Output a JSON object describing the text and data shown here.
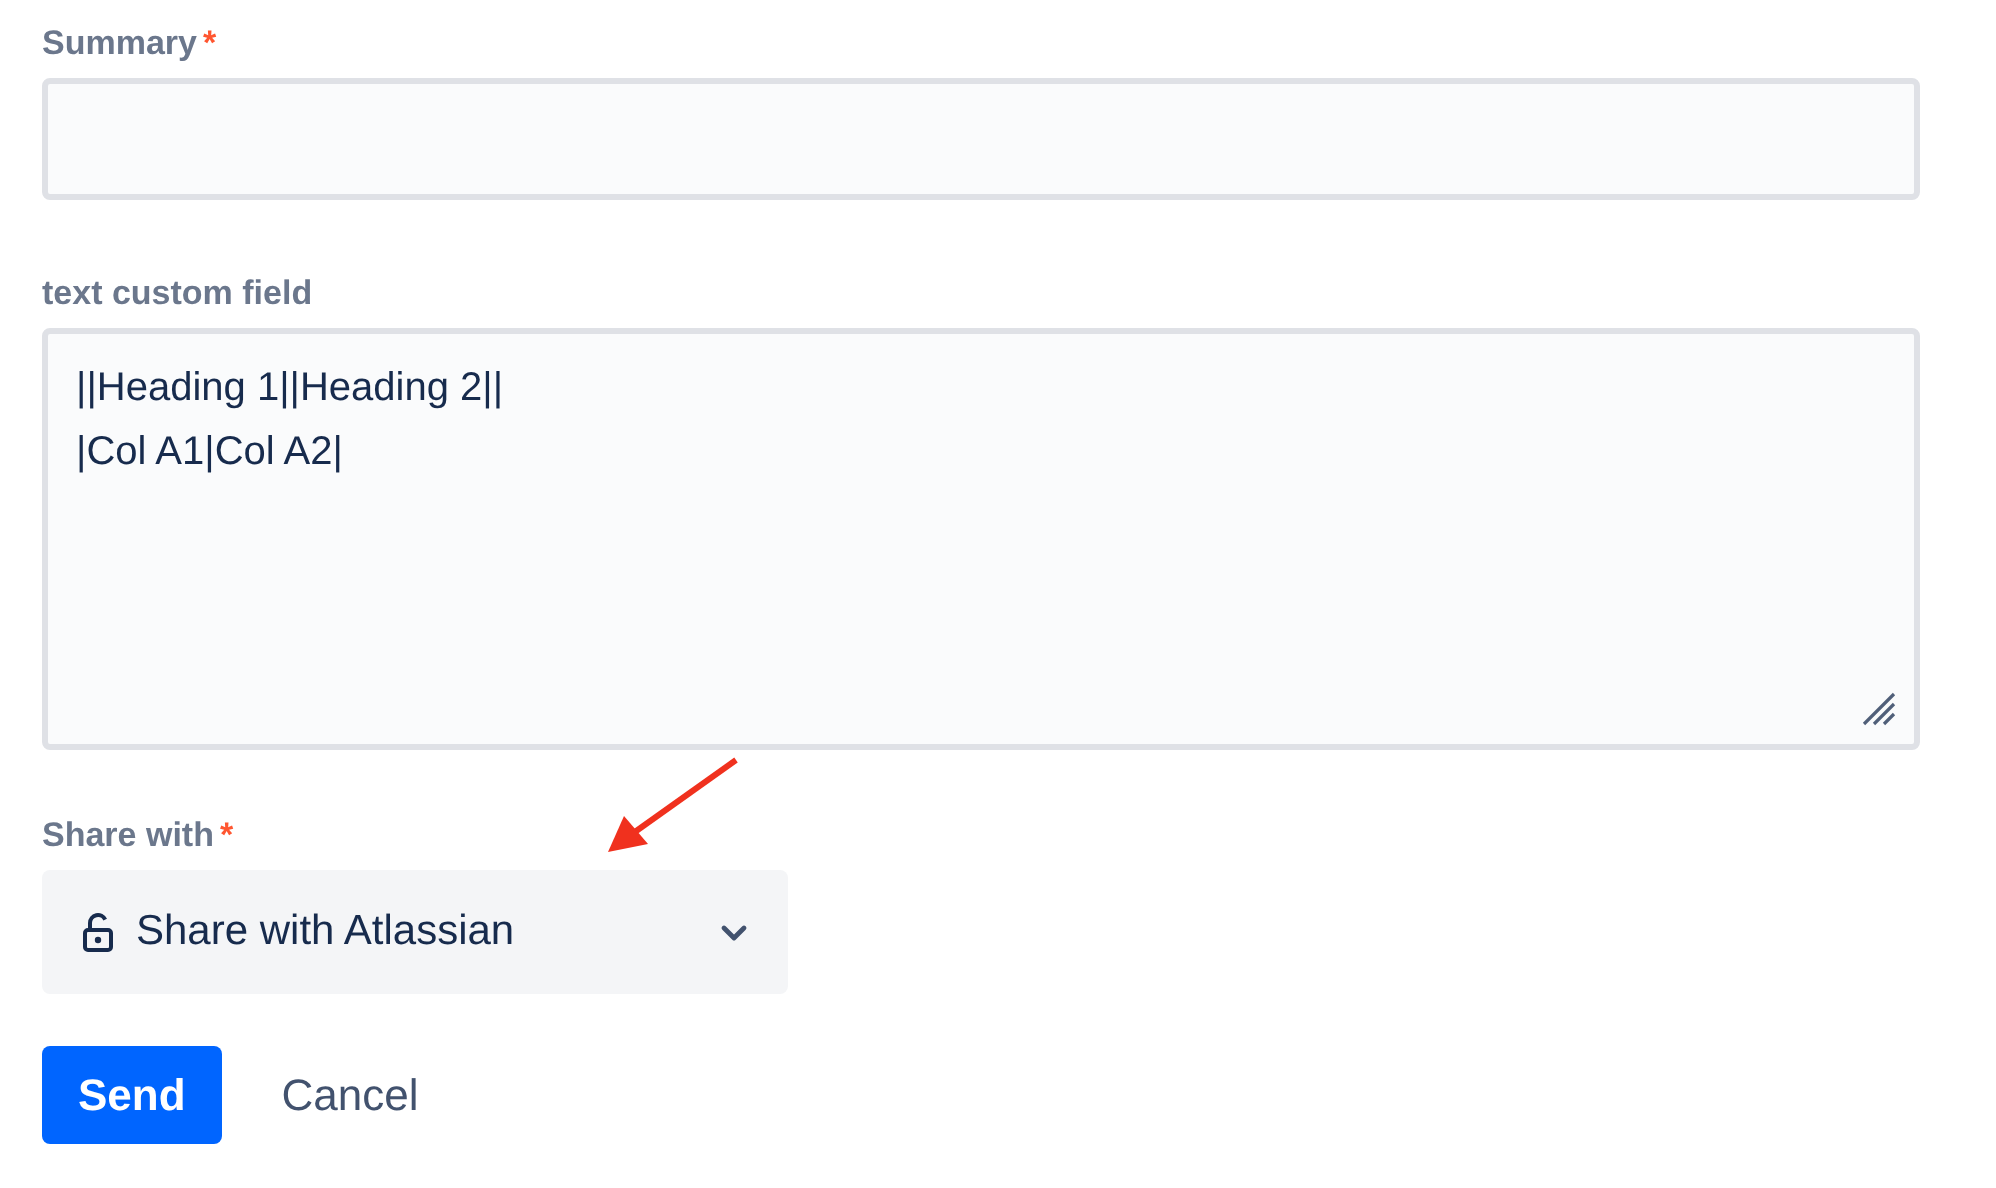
{
  "fields": [
    {
      "kind": "input",
      "label": "Summary",
      "required_mark": "*"
    },
    {
      "kind": "textarea",
      "label": "text custom field",
      "value": "||Heading 1||Heading 2||\n|Col A1|Col A2|"
    },
    {
      "kind": "select",
      "label": "Share with",
      "required_mark": "*",
      "value": "Share with Atlassian"
    }
  ],
  "buttons": [
    {
      "label": "Send",
      "kind": "primary"
    },
    {
      "label": "Cancel",
      "kind": "subtle"
    }
  ],
  "annotation": {
    "kind": "arrow"
  }
}
